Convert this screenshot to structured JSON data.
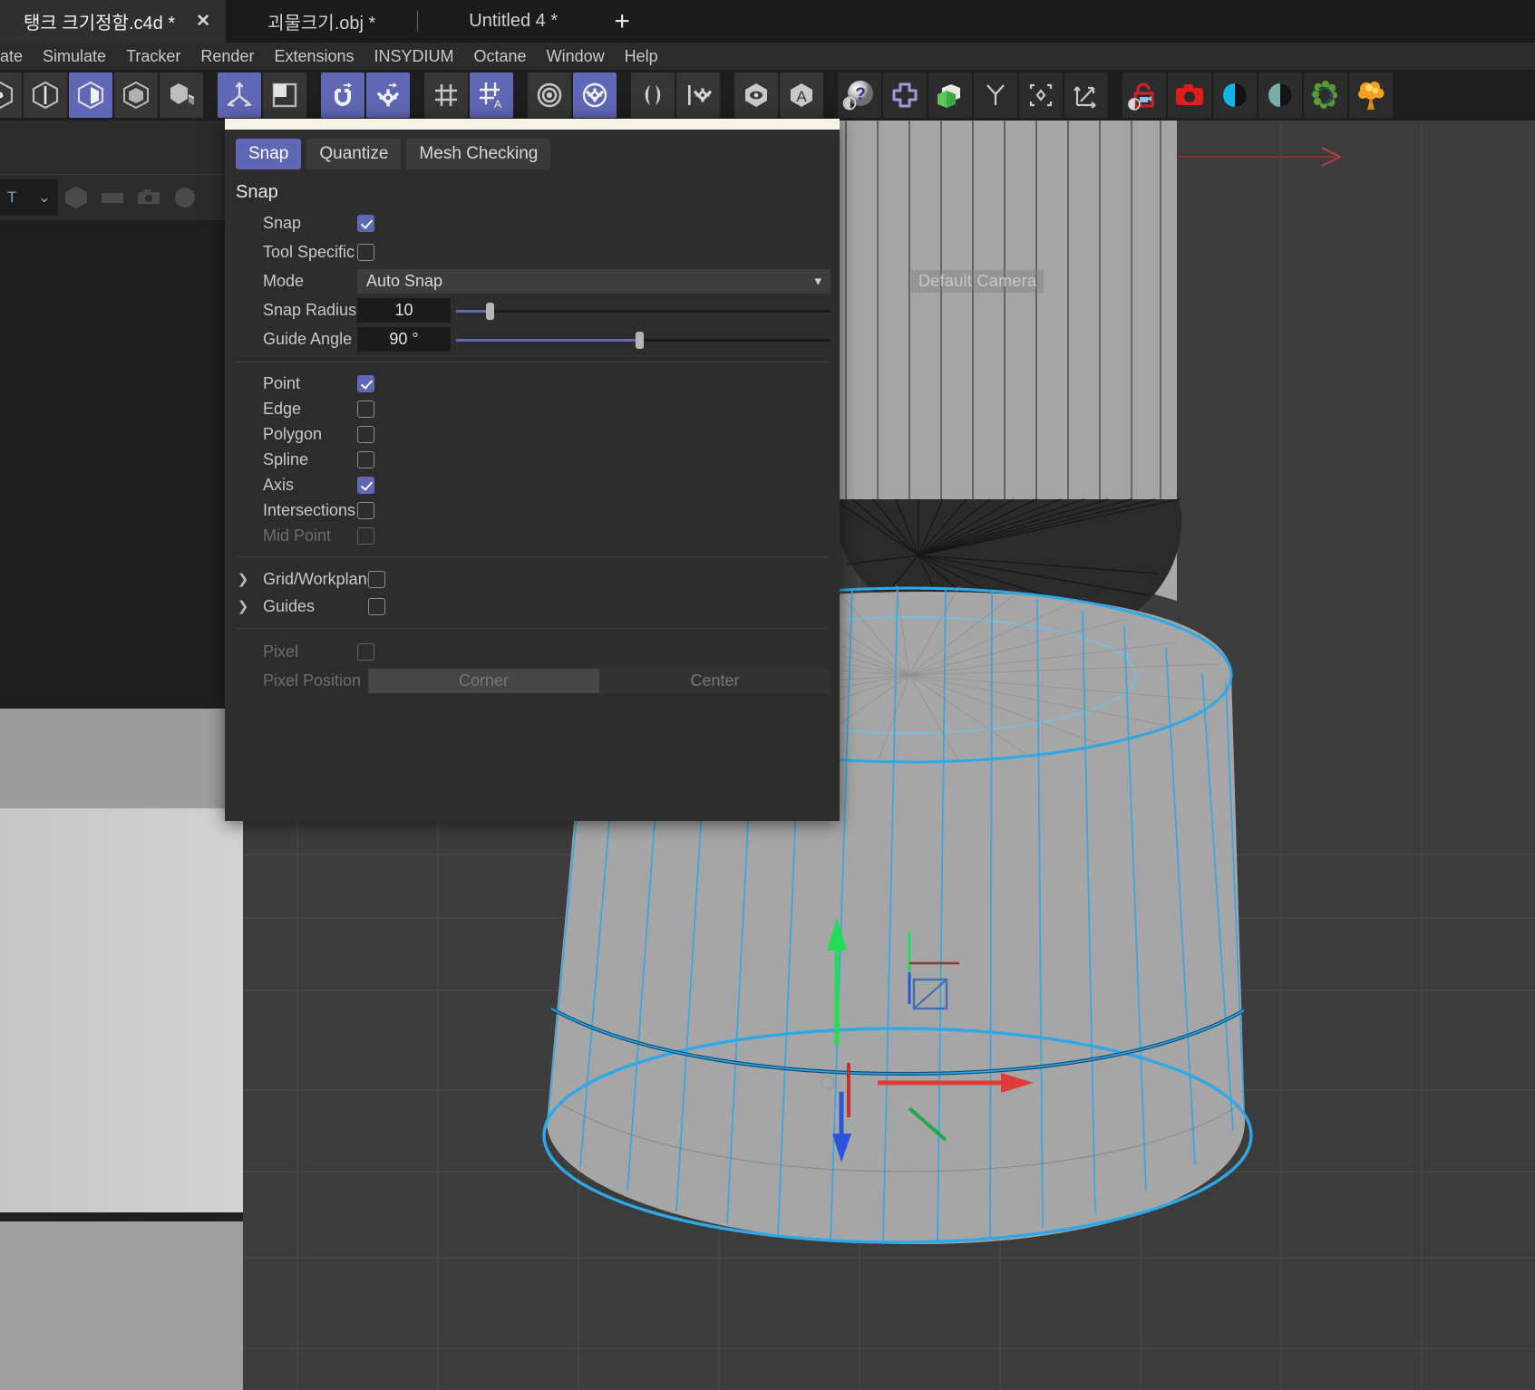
{
  "tabs": [
    {
      "label": "탱크 크기정함.c4d *",
      "active": true,
      "close": "✕"
    },
    {
      "label": "괴물크기.obj *",
      "active": false
    },
    {
      "label": "Untitled 4 *",
      "active": false
    }
  ],
  "tab_add_label": "+",
  "menu": [
    "ate",
    "Simulate",
    "Tracker",
    "Render",
    "Extensions",
    "INSYDIUM",
    "Octane",
    "Window",
    "Help"
  ],
  "toolbar": {
    "groups": [
      {
        "buttons": [
          {
            "name": "point-mode-icon",
            "on": false
          },
          {
            "name": "edge-mode-icon",
            "on": false
          },
          {
            "name": "polygon-mode-icon",
            "on": true
          },
          {
            "name": "model-mode-icon",
            "on": false
          },
          {
            "name": "texture-mode-icon",
            "on": false
          }
        ]
      },
      {
        "buttons": [
          {
            "name": "axis-mode-icon",
            "on": true
          },
          {
            "name": "object-axis-icon",
            "on": false
          }
        ]
      },
      {
        "buttons": [
          {
            "name": "snap-magnet-icon",
            "on": true
          },
          {
            "name": "snap-settings-gear-icon",
            "on": true
          }
        ]
      },
      {
        "buttons": [
          {
            "name": "workplane-grid-icon",
            "on": false
          },
          {
            "name": "workplane-auto-icon",
            "on": true
          }
        ]
      },
      {
        "buttons": [
          {
            "name": "target-rings-icon",
            "on": false
          },
          {
            "name": "target-settings-icon",
            "on": true
          }
        ]
      },
      {
        "buttons": [
          {
            "name": "symmetry-mirror-icon",
            "on": false
          },
          {
            "name": "symmetry-settings-icon",
            "on": false
          }
        ]
      },
      {
        "buttons": [
          {
            "name": "viewport-visibility-icon",
            "on": false
          },
          {
            "name": "annotation-a-icon",
            "on": false
          }
        ]
      },
      {
        "buttons": [
          {
            "name": "help-question-sphere-icon",
            "on": false
          },
          {
            "name": "cinema4d-plugin-icon",
            "on": false
          },
          {
            "name": "boole-cubes-icon",
            "on": false
          },
          {
            "name": "connect-merge-icon",
            "on": false
          },
          {
            "name": "center-axis-icon",
            "on": false
          },
          {
            "name": "scale-expand-icon",
            "on": false
          }
        ]
      },
      {
        "buttons": [
          {
            "name": "unlock-camera-icon",
            "on": false
          },
          {
            "name": "render-camera-icon",
            "on": false
          },
          {
            "name": "contrast-blue-icon",
            "on": false
          },
          {
            "name": "contrast-teal-icon",
            "on": false
          },
          {
            "name": "scatter-foliage-icon",
            "on": false
          },
          {
            "name": "explosion-fx-icon",
            "on": false
          }
        ]
      }
    ]
  },
  "left_panel": {
    "select_value": "T",
    "chevron": "⌄",
    "icons": [
      "hex-object-icon",
      "rect-object-icon",
      "camera-object-icon",
      "circle-object-icon"
    ]
  },
  "viewport": {
    "camera_label": "Default Camera",
    "background_color": "#3c3c3c",
    "wireframe_color": "#2ca8e8",
    "axis_colors": {
      "x": "#e03a3a",
      "y": "#22dd55",
      "z": "#2a55dd"
    }
  },
  "dialog": {
    "titlebar_color": "#f6f3e6",
    "tabs": [
      {
        "label": "Snap",
        "active": true
      },
      {
        "label": "Quantize",
        "active": false
      },
      {
        "label": "Mesh Checking",
        "active": false
      }
    ],
    "section_title": "Snap",
    "rows": [
      {
        "label": "Snap",
        "type": "checkbox",
        "checked": true,
        "disabled": false
      },
      {
        "label": "Tool Specific",
        "type": "checkbox",
        "checked": false,
        "disabled": false
      },
      {
        "label": "Mode",
        "type": "dropdown",
        "value": "Auto Snap",
        "arrow": "▾"
      },
      {
        "label": "Snap Radius",
        "type": "slider",
        "value": "10",
        "percent": 9
      },
      {
        "label": "Guide Angle",
        "type": "slider",
        "value": "90 °",
        "percent": 49
      }
    ],
    "snap_targets": [
      {
        "label": "Point",
        "checked": true,
        "disabled": false
      },
      {
        "label": "Edge",
        "checked": false,
        "disabled": false
      },
      {
        "label": "Polygon",
        "checked": false,
        "disabled": false
      },
      {
        "label": "Spline",
        "checked": false,
        "disabled": false
      },
      {
        "label": "Axis",
        "checked": true,
        "disabled": false
      },
      {
        "label": "Intersections",
        "checked": false,
        "disabled": false
      },
      {
        "label": "Mid Point",
        "checked": false,
        "disabled": true
      }
    ],
    "tree_rows": [
      {
        "label": "Grid/Workplane",
        "checked": false,
        "chevron": "❯"
      },
      {
        "label": "Guides",
        "checked": false,
        "chevron": "❯"
      }
    ],
    "pixel_row": {
      "label": "Pixel",
      "checked": false,
      "disabled": true
    },
    "pixel_position": {
      "label": "Pixel Position",
      "options": [
        {
          "label": "Corner",
          "selected": true
        },
        {
          "label": "Center",
          "selected": false
        }
      ]
    },
    "accent_color": "#6067b4"
  }
}
